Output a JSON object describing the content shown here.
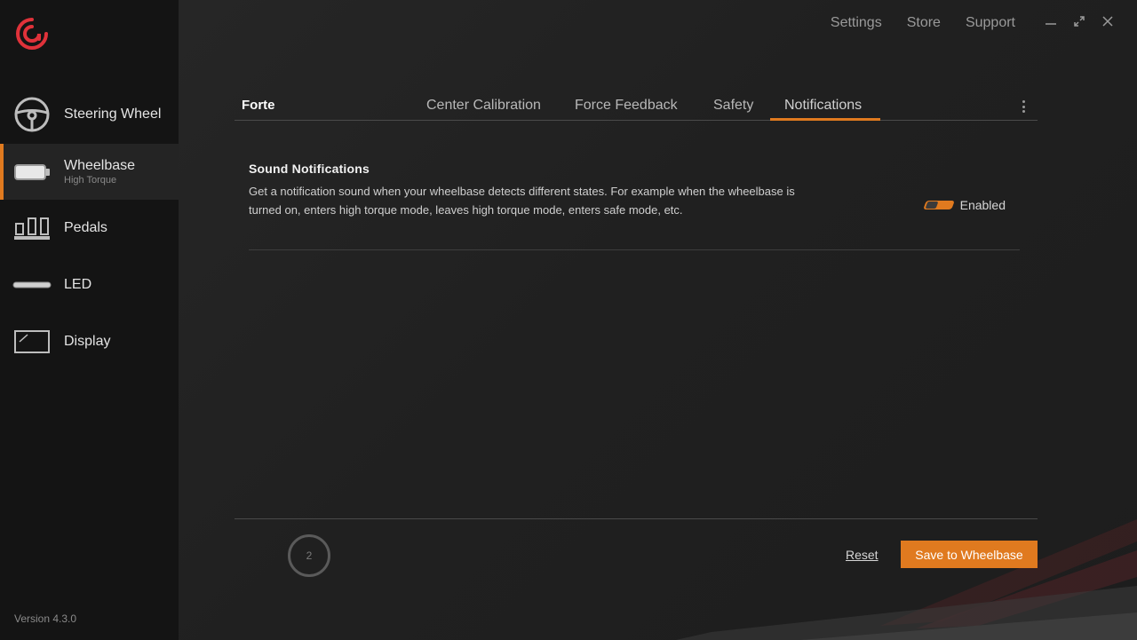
{
  "colors": {
    "accent": "#e07a1f",
    "sidebar_bg": "#141414",
    "main_bg": "#222222"
  },
  "sidebar": {
    "items": [
      {
        "label": "Steering Wheel",
        "sub": "",
        "icon": "steering-wheel-icon"
      },
      {
        "label": "Wheelbase",
        "sub": "High Torque",
        "icon": "wheelbase-icon",
        "active": true
      },
      {
        "label": "Pedals",
        "sub": "",
        "icon": "pedals-icon"
      },
      {
        "label": "LED",
        "sub": "",
        "icon": "led-icon"
      },
      {
        "label": "Display",
        "sub": "",
        "icon": "display-icon"
      }
    ],
    "version": "Version 4.3.0"
  },
  "topnav": {
    "settings": "Settings",
    "store": "Store",
    "support": "Support"
  },
  "tabs": {
    "device": "Forte",
    "items": [
      "Center Calibration",
      "Force Feedback",
      "Safety",
      "Notifications"
    ],
    "active": "Notifications"
  },
  "setting": {
    "title": "Sound Notifications",
    "description": "Get a notification sound when your wheelbase detects different states. For example when the wheelbase is turned on, enters high torque mode, leaves high torque mode, enters safe mode, etc.",
    "toggle_label": "Enabled"
  },
  "footer": {
    "spinner_value": "2",
    "reset": "Reset",
    "save": "Save to Wheelbase"
  }
}
